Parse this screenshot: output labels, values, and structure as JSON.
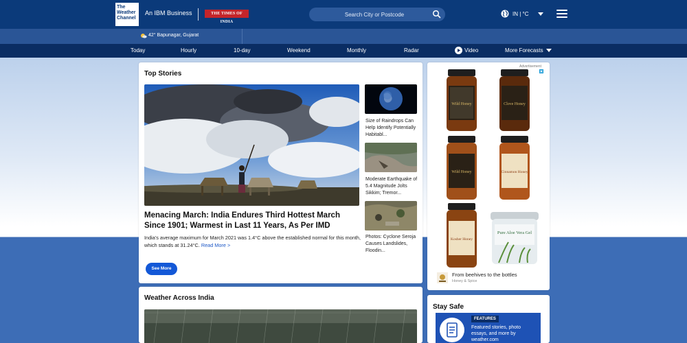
{
  "header": {
    "logo_text": "The Weather Channel",
    "ibm_text": "An IBM Business",
    "partner_text": "THE TIMES OF INDIA",
    "search_placeholder": "Search City or Postcode",
    "locale": "IN  |  °C"
  },
  "location": {
    "temp": "42°",
    "place": "Bapunagar, Gujarat"
  },
  "nav": {
    "items": [
      "Today",
      "Hourly",
      "10-day",
      "Weekend",
      "Monthly",
      "Radar",
      "Video",
      "More Forecasts"
    ]
  },
  "top_stories": {
    "title": "Top Stories",
    "headline": "Menacing March: India Endures Third Hottest March Since 1901; Warmest in Last 11 Years, As Per IMD",
    "summary": "India's average maximum for March 2021 was 1.4°C above the established normal for this month, which stands at 31.24°C.",
    "read_more": "Read More >",
    "see_more": "See More",
    "side_stories": [
      {
        "title": "Size of Raindrops Can Help Identify Potentially Habitabl..."
      },
      {
        "title": "Moderate Earthquake of 5.4 Magnitude Jolts Sikkim; Tremor..."
      },
      {
        "title": "Photos: Cyclone Seroja Causes Landslides, Floodin..."
      }
    ]
  },
  "ad": {
    "label": "Advertisement",
    "title": "From beehives to the bottles",
    "subtitle": "Honey & Spice",
    "jar_labels": [
      "Wild Honey",
      "Clove Honey",
      "Wild Honey",
      "Cinnamon Honey",
      "Kosher Honey"
    ],
    "aloe_label": "Pure Aloe Vera Gel"
  },
  "weather_india": {
    "title": "Weather Across India"
  },
  "stay_safe": {
    "title": "Stay Safe",
    "tag": "FEATURES",
    "text": "Featured stories, photo essays, and more by weather.com"
  }
}
